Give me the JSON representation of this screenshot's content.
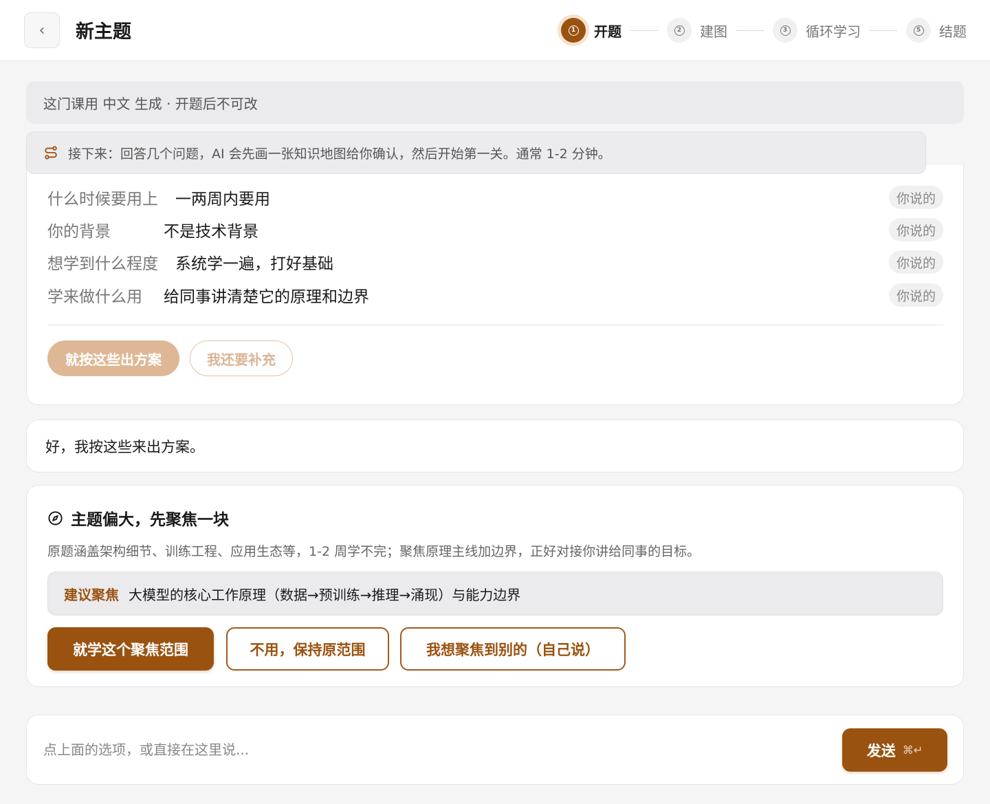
{
  "header": {
    "back_icon": "chevron-left-icon",
    "back_glyph": "‹",
    "title": "新主题",
    "steps": [
      {
        "num": "1",
        "label": "开题",
        "active": true
      },
      {
        "num": "2",
        "label": "建图",
        "active": false
      },
      {
        "num": "3",
        "label": "循环学习",
        "active": false
      },
      {
        "num": "5",
        "label": "结题",
        "active": false
      }
    ]
  },
  "language_banner": {
    "text": "这门课用 中文 生成 · 开题后不可改"
  },
  "hint_banner": {
    "icon": "route-icon",
    "text": "接下来：回答几个问题，AI 会先画一张知识地图给你确认，然后开始第一关。通常 1-2 分钟。"
  },
  "answers": {
    "rows": [
      {
        "key": "什么时候要用上",
        "value": "一两周内要用",
        "tag": "你说的"
      },
      {
        "key": "你的背景",
        "value": "不是技术背景",
        "tag": "你说的"
      },
      {
        "key": "想学到什么程度",
        "value": "系统学一遍，打好基础",
        "tag": "你说的"
      },
      {
        "key": "学来做什么用",
        "value": "给同事讲清楚它的原理和边界",
        "tag": "你说的"
      }
    ],
    "confirm_label": "就按这些出方案",
    "add_more_label": "我还要补充"
  },
  "ack_message": "好，我按这些来出方案。",
  "focus": {
    "icon": "compass-icon",
    "title": "主题偏大，先聚焦一块",
    "description": "原题涵盖架构细节、训练工程、应用生态等，1-2 周学不完；聚焦原理主线加边界，正好对接你讲给同事的目标。",
    "suggest_tag": "建议聚焦",
    "suggest_text": "大模型的核心工作原理（数据→预训练→推理→涌现）与能力边界",
    "accept_label": "就学这个聚焦范围",
    "keep_label": "不用，保持原范围",
    "other_label": "我想聚焦到别的（自己说）"
  },
  "composer": {
    "placeholder": "点上面的选项，或直接在这里说...",
    "value": "",
    "send_label": "发送",
    "send_shortcut": "⌘↵"
  },
  "colors": {
    "accent": "#9a5210",
    "accent_disabled": "#deb895",
    "background": "#f5f5f6"
  }
}
